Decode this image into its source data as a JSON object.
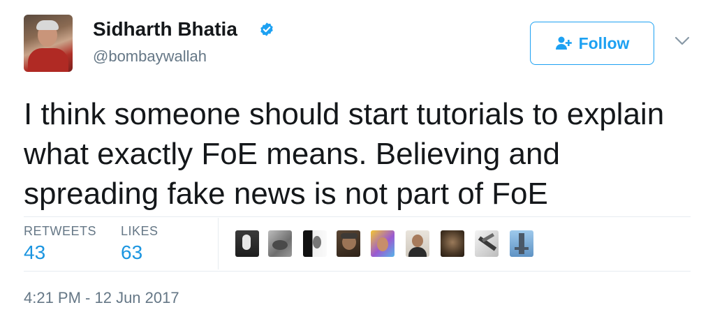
{
  "author": {
    "name": "Sidharth Bhatia",
    "handle": "@bombaywallah",
    "verified": true,
    "avatar_icon": "profile-photo"
  },
  "follow_button": {
    "label": "Follow",
    "icon": "add-user-icon"
  },
  "menu_icon": "chevron-down-icon",
  "tweet": {
    "text": "I think someone should start tutorials to explain what exactly FoE means. Believing and spreading fake news is not part of FoE"
  },
  "stats": {
    "retweets_label": "RETWEETS",
    "retweets_value": "43",
    "likes_label": "LIKES",
    "likes_value": "63"
  },
  "timestamp": "4:21 PM - 12 Jun 2017",
  "colors": {
    "accent": "#1da1f2",
    "stat_value": "#1b95e0",
    "secondary_text": "#657786",
    "divider": "#e6ecf0"
  }
}
